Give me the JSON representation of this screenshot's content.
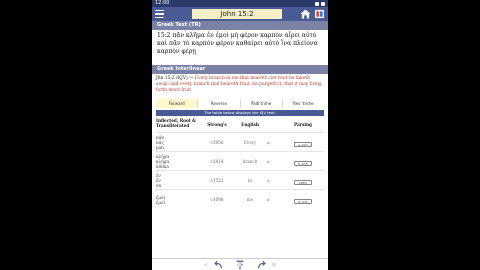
{
  "status_bar": {
    "time": "12:00"
  },
  "app_bar": {
    "reference": "John 15:2"
  },
  "greek_text": {
    "header": "Greek Text (TR)",
    "text": "15:2 πᾶν κλῆμα ἐν ἐμοὶ μὴ φέρον καρπὸν αἴρει αὐτό καὶ πᾶν  τὸ καρπὸν φέρον καθαίρει αὐτὸ ἵνα πλείονα καρπὸν φέρῃ"
  },
  "interlinear": {
    "header": "Greek Interlinear",
    "verse_ref": "Jhn 15:2 (KJV) —",
    "verse_text": "Every branch in me that beareth not fruit he taketh away: and every branch that beareth fruit, he purgeth it, that it may bring forth more fruit."
  },
  "tabs": [
    {
      "label": "Forward"
    },
    {
      "label": "Reverse"
    },
    {
      "label": "Padi'trime"
    },
    {
      "label": "Rev 'trime"
    }
  ],
  "table_note": "The table below displays the KJV text.",
  "table_headers": {
    "word": "Inflected, Root & Transliterated",
    "strongs": "Strong's",
    "english": "English",
    "parsing": "Parsing"
  },
  "rows": [
    {
      "inflected": "πᾶν",
      "root": "πᾶς",
      "translit": "pan",
      "strongs": "3956",
      "english": "Every",
      "parsing": "A-ASN"
    },
    {
      "inflected": "κλῆμα",
      "root": "κλῆμα",
      "translit": "klēma",
      "strongs": "2814",
      "english": "branch",
      "parsing": "N-ASN"
    },
    {
      "inflected": "ἐν",
      "root": "ἐν",
      "translit": "en",
      "strongs": "1722",
      "english": "in",
      "parsing": "PREP"
    },
    {
      "inflected": "ἐμοὶ",
      "root": "ἐμοὶ",
      "translit": "",
      "strongs": "1698",
      "english": "me",
      "parsing": "P-1DS"
    }
  ],
  "icons": {
    "menu": "hamburger-icon",
    "home": "home-icon",
    "ebook": "ebook-icon",
    "back": "curved-arrow-left-icon",
    "top": "arrow-up-icon",
    "forward": "curved-arrow-right-icon",
    "speaker": "speaker-icon"
  },
  "colors": {
    "app_bar": "#4a5a94",
    "status_bar": "#2c3a6b",
    "section_header": "#7b82a6",
    "reference_bg": "#f6efc6",
    "verse_text": "#c0392b",
    "active_tab": "#fff8cc"
  }
}
